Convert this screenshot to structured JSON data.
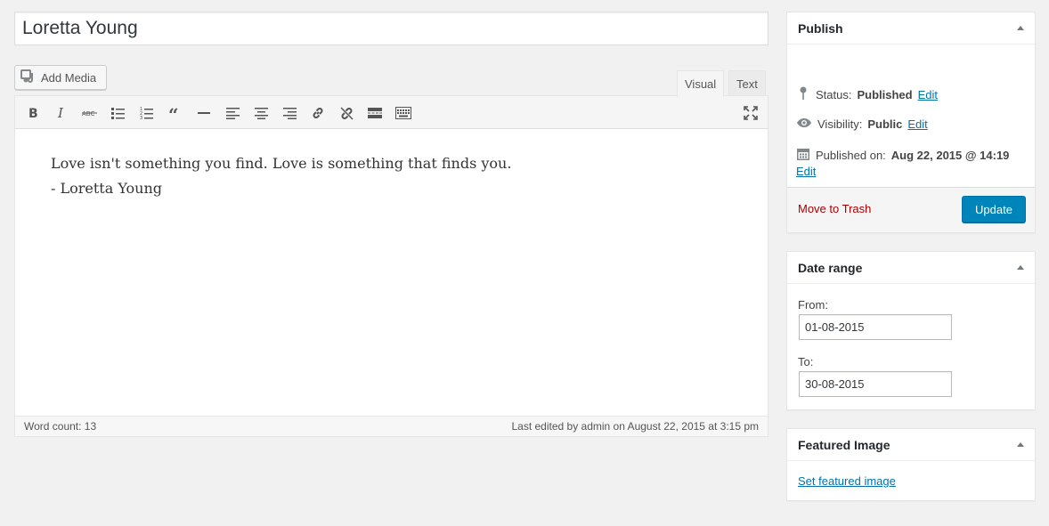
{
  "post": {
    "title": "Loretta Young"
  },
  "editor": {
    "add_media_label": "Add Media",
    "tabs": [
      {
        "label": "Visual",
        "active": true
      },
      {
        "label": "Text",
        "active": false
      }
    ],
    "toolbar": [
      "bold-icon",
      "italic-icon",
      "strikethrough-icon",
      "bullet-list-icon",
      "numbered-list-icon",
      "blockquote-icon",
      "horizontal-line-icon",
      "align-left-icon",
      "align-center-icon",
      "align-right-icon",
      "link-icon",
      "unlink-icon",
      "read-more-icon",
      "toolbar-toggle-icon",
      "fullscreen-icon"
    ],
    "content": {
      "line1": "Love isn't something you find. Love is something that finds you.",
      "line2": "- Loretta Young"
    },
    "word_count": "Word count: 13",
    "last_edited": "Last edited by admin on August 22, 2015 at 3:15 pm"
  },
  "publish": {
    "title": "Publish",
    "status_label": "Status:",
    "status_value": "Published",
    "visibility_label": "Visibility:",
    "visibility_value": "Public",
    "published_label": "Published on:",
    "published_value": "Aug 22, 2015 @ 14:19",
    "edit_label": "Edit",
    "trash_label": "Move to Trash",
    "update_label": "Update"
  },
  "date_range": {
    "title": "Date range",
    "from_label": "From:",
    "from_value": "01-08-2015",
    "to_label": "To:",
    "to_value": "30-08-2015"
  },
  "featured_image": {
    "title": "Featured Image",
    "link_label": "Set featured image"
  },
  "colors": {
    "accent": "#0085ba",
    "link": "#0073aa",
    "danger": "#a00",
    "background": "#f1f1f1"
  }
}
